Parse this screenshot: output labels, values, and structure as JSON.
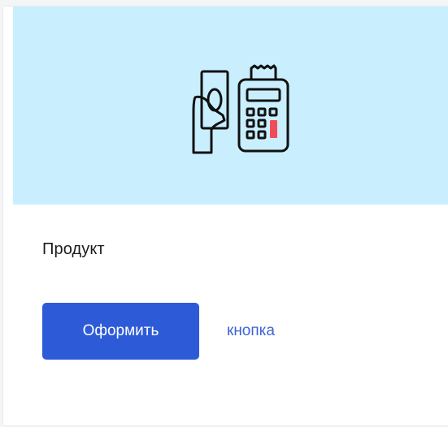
{
  "card": {
    "title": "Продукт",
    "primary_button_label": "Оформить",
    "secondary_link_label": "кнопка",
    "illustration_icon": "cash-payment-terminal-icon"
  },
  "colors": {
    "banner_background": "#c9efff",
    "primary_button": "#2d5bd8",
    "link": "#3e63d6",
    "terminal_accent": "#ef4d57"
  }
}
